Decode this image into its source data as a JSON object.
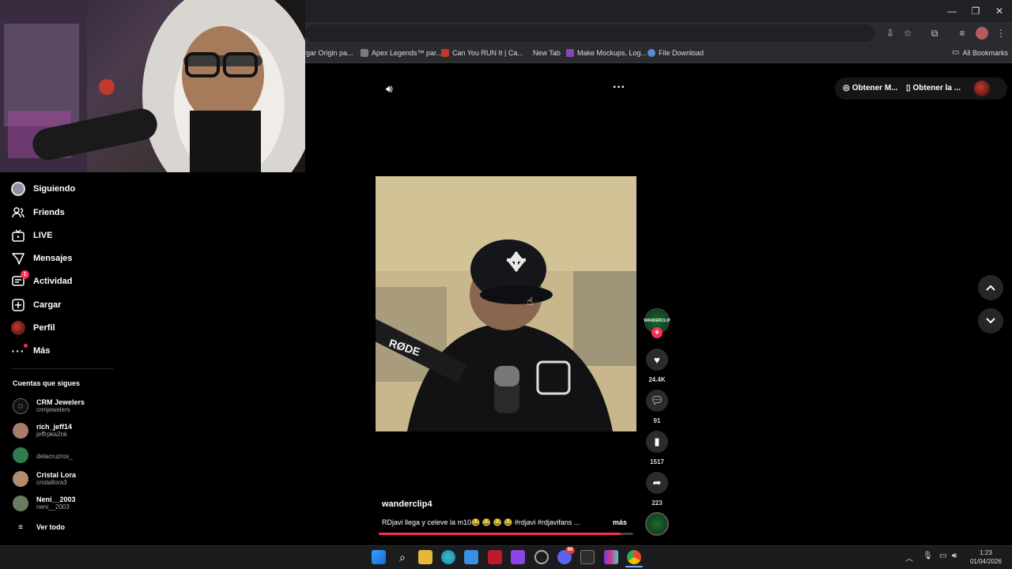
{
  "browser": {
    "window_controls": {
      "minimize": "—",
      "maximize": "❐",
      "close": "✕"
    },
    "bookmarks": [
      {
        "label": "rgar Origin pa...",
        "color": "#444"
      },
      {
        "label": "Apex Legends™ par...",
        "color": "#7a7a7a"
      },
      {
        "label": "Can You RUN It | Ca...",
        "color": "#c0392b"
      },
      {
        "label": "New Tab",
        "color": "#292b2f"
      },
      {
        "label": "Make Mockups, Log...",
        "color": "#8e44ad"
      },
      {
        "label": "File Download",
        "color": "#5d8bd1"
      }
    ],
    "all_bookmarks": "All Bookmarks"
  },
  "sidebar": {
    "nav": [
      {
        "icon": "following-avatar-icon",
        "label": "Siguiendo"
      },
      {
        "icon": "friends-icon",
        "label": "Friends"
      },
      {
        "icon": "live-tv-icon",
        "label": "LIVE"
      },
      {
        "icon": "messages-icon",
        "label": "Mensajes"
      },
      {
        "icon": "activity-icon",
        "label": "Actividad",
        "badge": "1"
      },
      {
        "icon": "upload-icon",
        "label": "Cargar"
      },
      {
        "icon": "profile-avatar-icon",
        "label": "Perfil"
      },
      {
        "icon": "more-icon",
        "label": "Más"
      }
    ],
    "following_title": "Cuentas que sigues",
    "accounts": [
      {
        "name": "CRM Jewelers",
        "handle": "crmjewelers",
        "color": "#222"
      },
      {
        "name": "rich_jeff14",
        "handle": "jeffrpka2nk",
        "color": "#a87c6a"
      },
      {
        "name": "",
        "handle": "delacruzros_",
        "color": "#2f7d4e"
      },
      {
        "name": "Cristal Lora",
        "handle": "cristallora3",
        "color": "#b28c6f"
      },
      {
        "name": "Neni__2003",
        "handle": "neni__2003",
        "color": "#6b7b5e"
      }
    ],
    "see_all": "Ver todo"
  },
  "topbar": {
    "get_coins": "Obtener M...",
    "get_app": "Obtener la ..."
  },
  "video": {
    "username": "wanderclip4",
    "caption": "RDjavi llega y celeve la m10😂 😂 😂 😂 #rdjavi #rdjavifans ...",
    "more": "más",
    "mic_brand": "RØDE",
    "progress": 0.95,
    "likes": "24.4K",
    "comments": "91",
    "saves": "1517",
    "shares": "223",
    "avatar_text": "WANDERCLIP",
    "follow_plus": "+"
  },
  "taskbar": {
    "time": "1:23",
    "date": "01/04/2026",
    "apps": [
      "start-icon",
      "search-icon",
      "file-explorer-icon",
      "edge-icon",
      "store-icon",
      "amd-icon",
      "twitch-icon",
      "clock-app-icon",
      "discord-icon",
      "epic-games-icon",
      "winrar-icon",
      "chrome-icon"
    ],
    "discord_badge": "99"
  },
  "colors": {
    "accent": "#fe2c55",
    "bg": "#000000"
  }
}
